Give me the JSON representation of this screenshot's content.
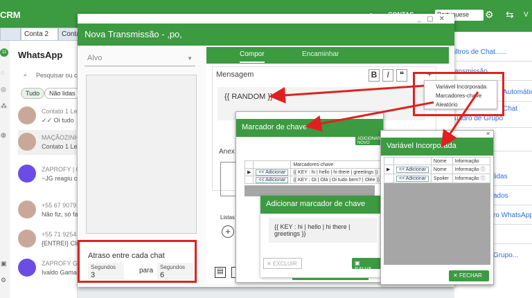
{
  "app": {
    "brand": "CRM",
    "language": "Portuguese",
    "contas_label": "CONTAS"
  },
  "tabs": [
    "",
    "Conta 2",
    "Conta"
  ],
  "whatsapp": {
    "title": "WhatsApp",
    "search_placeholder": "Pesquisar ou con",
    "filters": [
      "Tudo",
      "Não lidas"
    ],
    "badge": "11",
    "contacts": [
      {
        "name": "Contato 1 Lead",
        "msg": "✓✓ Oi tudo"
      },
      {
        "name": "MAÇÃOZINHA",
        "msg": "Contato 1 Lead"
      },
      {
        "name": "ZAPROFY | GA",
        "msg": "~JG reagiu co"
      },
      {
        "name": "+55 67 9079",
        "msg": "Não fiz, só fale"
      },
      {
        "name": "+55 71 9254",
        "msg": "{ENTREI} Cliqu"
      },
      {
        "name": "ZAPROFY GUIA",
        "msg": "Ivaldo Gama r"
      }
    ]
  },
  "right_links": [
    "iltros de Chat......",
    "ansmissão",
    "Automátic",
    "Chat",
    "uadro de Grupo",
    "lidas",
    "ados",
    "ro WhatsApp",
    "Grupo..."
  ],
  "modal": {
    "title": "Nova Transmissão - ,po,",
    "alvo_label": "Alvo",
    "tabs": {
      "compor": "Compor",
      "encaminhar": "Encaminhar"
    },
    "mensagem_label": "Mensagem",
    "format_buttons": [
      "B",
      "I",
      "❝",
      "+"
    ],
    "message_text": "{{ RANDOM }}",
    "anexo_label": "Anex",
    "listas_label": "Listas",
    "atraso": {
      "label": "Atraso entre cada chat",
      "seg1_label": "Segundos",
      "seg1_value": "3",
      "para": "para",
      "seg2_label": "Segundos",
      "seg2_value": "6"
    }
  },
  "menu": {
    "items": [
      "Variável Incorporada",
      "Marcadores-chave",
      "Aleatório"
    ]
  },
  "marcador": {
    "title": "Marcador de chave",
    "add_button": "ADICIONAR NOVO",
    "table_header": "Marcadores-chave",
    "rows": [
      {
        "action": "<< Adicionar",
        "value": "{{ KEY : hi | hello | hi there | greetings }}"
      },
      {
        "action": "<< Adicionar",
        "value": "{{ KEY : Oi | Olá | Oi tudo bem? | Olée }}"
      }
    ]
  },
  "adicionar": {
    "title": "Adicionar marcador de chave",
    "text": "{{ KEY : hi | hello | hi there | greetings }}",
    "excluir": "EXCLUIR",
    "salvar": "SALVA"
  },
  "variavel": {
    "title": "Variável Incorporada",
    "headers": [
      "Nome",
      "Informação"
    ],
    "rows": [
      {
        "action": "<< Adicionar",
        "name": "Nome",
        "info": "Informação ⓘ"
      },
      {
        "action": "<< Adicionar",
        "name": "Spoiler",
        "info": "Informação ⓘ"
      }
    ],
    "fechar": "FECHAR"
  },
  "colors": {
    "green": "#3c9a40",
    "red": "#e02020",
    "link": "#2e6fdc"
  }
}
